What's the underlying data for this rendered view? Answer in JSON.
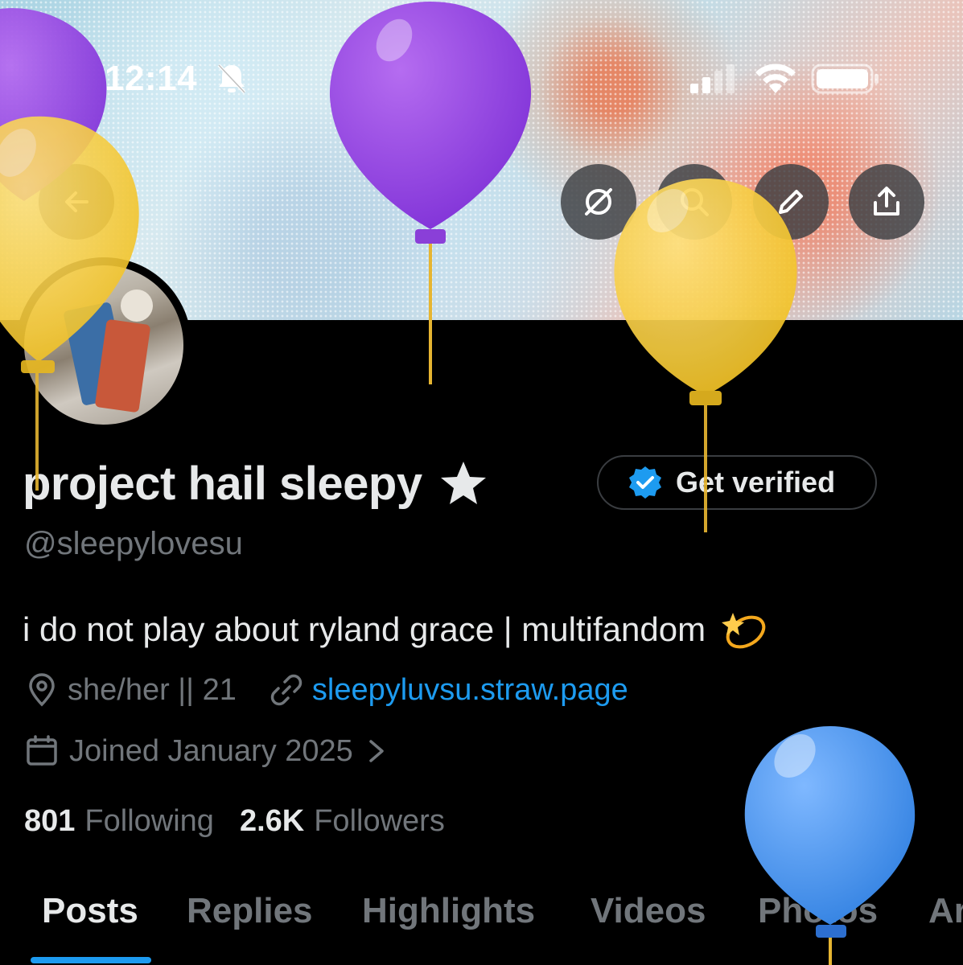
{
  "status_bar": {
    "time": "12:14",
    "icons": [
      "bell-off-icon",
      "signal-icon",
      "wifi-icon",
      "battery-icon"
    ]
  },
  "header_actions": [
    "back-arrow-icon",
    "grok-icon",
    "search-icon",
    "edit-pencil-icon",
    "share-icon"
  ],
  "profile": {
    "display_name": "project hail sleepy",
    "handle": "@sleepylovesu",
    "verify_label": "Get verified",
    "bio": "i do not play about ryland grace | multifandom",
    "pronouns": "she/her || 21",
    "website": "sleepyluvsu.straw.page",
    "joined": "Joined January 2025",
    "following_count": "801",
    "following_label": "Following",
    "followers_count": "2.6K",
    "followers_label": "Followers"
  },
  "tabs": [
    {
      "label": "Posts",
      "active": true
    },
    {
      "label": "Replies",
      "active": false
    },
    {
      "label": "Highlights",
      "active": false
    },
    {
      "label": "Videos",
      "active": false
    },
    {
      "label": "Photos",
      "active": false
    },
    {
      "label": "Ar",
      "active": false
    }
  ],
  "colors": {
    "accent": "#1d9bf0",
    "background": "#000000",
    "muted": "#71767b"
  }
}
